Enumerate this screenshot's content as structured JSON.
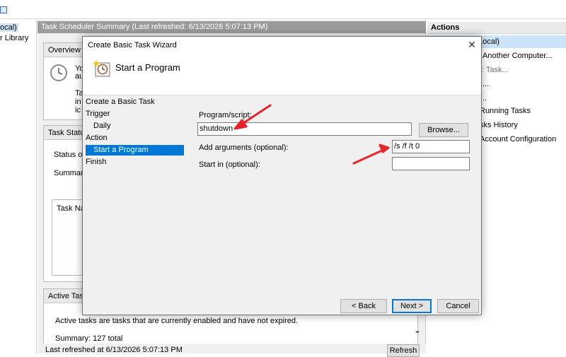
{
  "main_window": {
    "tree_items": [
      "ocal)",
      "r Library"
    ],
    "center_header": "Task Scheduler Summary (Last refreshed: 6/13/2026 5:07:13 PM)",
    "overview_title": "Overview o",
    "overview_lines": [
      "Yo",
      "au",
      "Ta",
      "in",
      "ic"
    ],
    "task_status_title": "Task Status",
    "status_of": "Status of",
    "summary": "Summar",
    "task_name": "Task Nar",
    "active_tasks_title": "Active Task",
    "active_desc": "Active tasks are tasks that are currently enabled and have not expired.",
    "active_summary": "Summary: 127 total",
    "last_refreshed": "Last refreshed at 6/13/2026 5:07:13 PM",
    "refresh_label": "Refresh",
    "scroll_down_glyph": "⌄"
  },
  "actions_pane": {
    "header": "Actions",
    "items": [
      "Local)",
      "Another Computer...",
      ": Task...",
      "...",
      "..",
      "Running Tasks",
      "sks History",
      "Account Configuration",
      ""
    ]
  },
  "dialog": {
    "title": "Create Basic Task Wizard",
    "close_glyph": "✕",
    "banner_title": "Start a Program",
    "steps": [
      "Create a Basic Task",
      "Trigger",
      "Daily",
      "Action",
      "Start a Program",
      "Finish"
    ],
    "program_label": "Program/script:",
    "program_value": "shutdown",
    "browse_label": "Browse...",
    "args_label": "Add arguments (optional):",
    "args_value": "/s /f /t 0",
    "startin_label": "Start in (optional):",
    "startin_value": "",
    "back_label": "< Back",
    "next_label": "Next >",
    "cancel_label": "Cancel"
  },
  "colors": {
    "selection": "#0078d7",
    "annotation_arrow": "#e8242b",
    "header_gray": "#9b9b9b"
  },
  "icons": [
    "clock-icon",
    "wizard-clock-icon",
    "close-icon",
    "window-icon"
  ]
}
